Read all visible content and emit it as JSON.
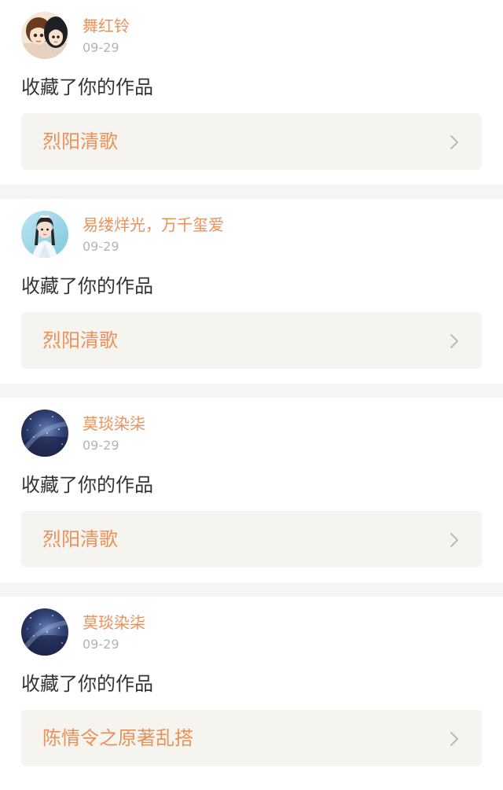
{
  "feed": [
    {
      "avatar": "anime-girls-avatar",
      "username": "舞红铃",
      "date": "09-29",
      "action": "收藏了你的作品",
      "work_title": "烈阳清歌"
    },
    {
      "avatar": "costume-character-avatar",
      "username": "易缕烊光，万千玺爱",
      "date": "09-29",
      "action": "收藏了你的作品",
      "work_title": "烈阳清歌"
    },
    {
      "avatar": "starry-sky-avatar",
      "username": "莫琰染柒",
      "date": "09-29",
      "action": "收藏了你的作品",
      "work_title": "烈阳清歌"
    },
    {
      "avatar": "starry-sky-avatar",
      "username": "莫琰染柒",
      "date": "09-29",
      "action": "收藏了你的作品",
      "work_title": "陈情令之原著乱搭"
    }
  ],
  "colors": {
    "accent": "#e9915a",
    "date": "#b4b4b4",
    "text": "#333333",
    "card_link_bg": "#f5f4ee",
    "separator": "#f6f5f3",
    "chevron": "#b9b9b9"
  }
}
